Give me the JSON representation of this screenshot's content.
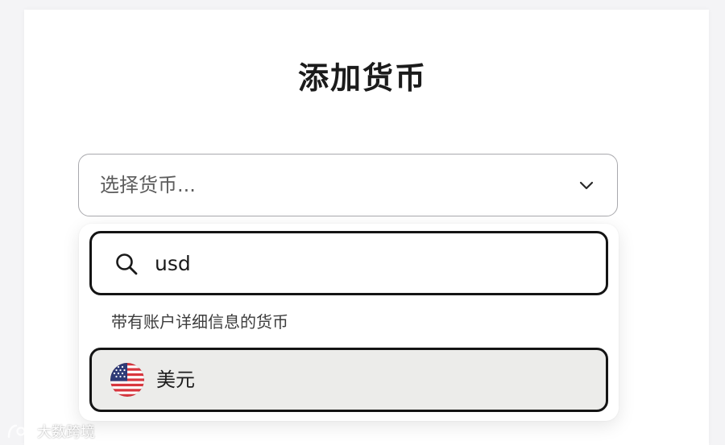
{
  "dialog": {
    "title": "添加货币"
  },
  "currency_select": {
    "placeholder": "选择货币...",
    "chevron_icon": "chevron-down-icon"
  },
  "dropdown": {
    "search": {
      "icon": "search-icon",
      "value": "usd"
    },
    "section_label": "带有账户详细信息的货币",
    "options": [
      {
        "label": "美元",
        "icon": "us-flag-icon",
        "selected": true
      }
    ]
  },
  "watermark": {
    "text": "大数跨境"
  },
  "colors": {
    "page_background": "#f4f4f6",
    "card_background": "#ffffff",
    "focus_border": "#141414",
    "highlight_background": "#ececea",
    "select_border": "#a9a9ad"
  }
}
